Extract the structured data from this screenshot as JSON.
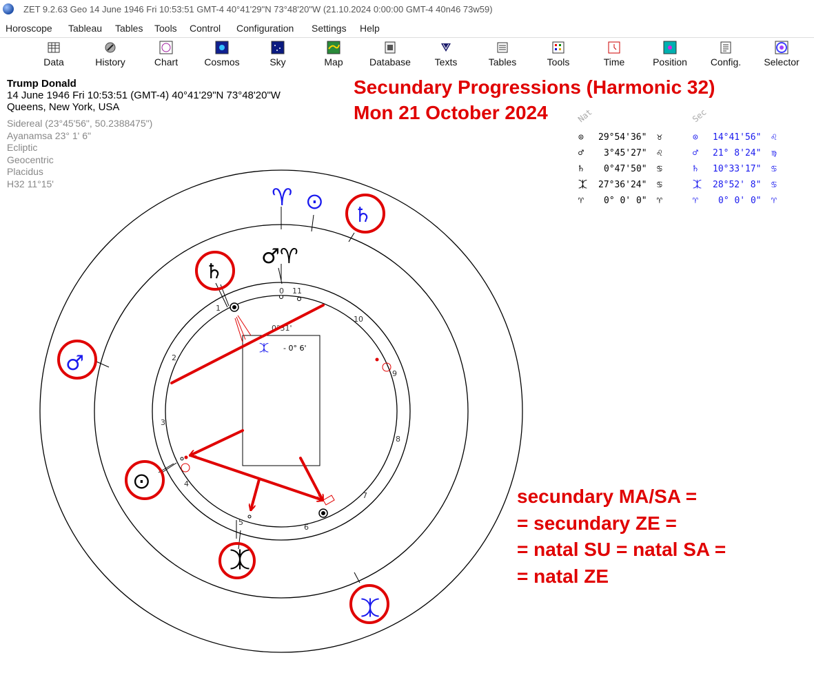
{
  "window": {
    "title": "ZET 9.2.63 Geo    14 June 1946  Fri  10:53:51 GMT-4 40°41'29\"N  73°48'20\"W  (21.10.2024   0:00:00 GMT-4 40n46 73w59)"
  },
  "menu": [
    "Horoscope",
    "Tableau",
    "Tables",
    "Tools",
    "Control",
    "Configuration",
    "Settings",
    "Help"
  ],
  "toolbar": [
    {
      "label": "Data",
      "icon": "data-icon"
    },
    {
      "label": "History",
      "icon": "history-icon"
    },
    {
      "label": "Chart",
      "icon": "chart-icon"
    },
    {
      "label": "Cosmos",
      "icon": "cosmos-icon"
    },
    {
      "label": "Sky",
      "icon": "sky-icon"
    },
    {
      "label": "Map",
      "icon": "map-icon"
    },
    {
      "label": "Database",
      "icon": "database-icon"
    },
    {
      "label": "Texts",
      "icon": "texts-icon"
    },
    {
      "label": "Tables",
      "icon": "tables-icon"
    },
    {
      "label": "Tools",
      "icon": "tools-icon"
    },
    {
      "label": "Time",
      "icon": "time-icon"
    },
    {
      "label": "Position",
      "icon": "position-icon"
    },
    {
      "label": "Config.",
      "icon": "config-icon"
    },
    {
      "label": "Selector",
      "icon": "selector-icon"
    }
  ],
  "info": {
    "name": "Trump Donald",
    "datetime": "14 June 1946  Fri  10:53:51 (GMT-4) 40°41'29\"N  73°48'20\"W",
    "place": "Queens, New York, USA",
    "settings": [
      "Sidereal (23°45'56\", 50.2388475\")",
      "Ayanamsa 23° 1' 6\"",
      "Ecliptic",
      "Geocentric",
      "Placidus",
      "H32  11°15'"
    ]
  },
  "headline": {
    "line1": "Secundary Progressions (Harmonic 32)",
    "line2": "Mon 21 October 2024"
  },
  "positions": {
    "nat_header": "Nat",
    "sec_header": "Sec",
    "natal": [
      {
        "glyph": "⊙",
        "value": "29°54'36\"",
        "sign": "♉"
      },
      {
        "glyph": "♂",
        "value": "3°45'27\"",
        "sign": "♌"
      },
      {
        "glyph": "♄",
        "value": "0°47'50\"",
        "sign": "♋"
      },
      {
        "glyph": "⯰",
        "value": "27°36'24\"",
        "sign": "♋"
      },
      {
        "glyph": "♈",
        "value": "0° 0' 0\"",
        "sign": "♈"
      }
    ],
    "secondary": [
      {
        "glyph": "⊙",
        "value": "14°41'56\"",
        "sign": "♌"
      },
      {
        "glyph": "♂",
        "value": "21° 8'24\"",
        "sign": "♍"
      },
      {
        "glyph": "♄",
        "value": "10°33'17\"",
        "sign": "♋"
      },
      {
        "glyph": "⯰",
        "value": "28°52' 8\"",
        "sign": "♋"
      },
      {
        "glyph": "♈",
        "value": "0° 0' 0\"",
        "sign": "♈"
      }
    ],
    "colors": {
      "natal": "#000000",
      "secondary": "#1a1aee"
    }
  },
  "chart": {
    "inner_label_top": "0°31'",
    "box_glyph": "⯰",
    "box_value": "- 0° 6'",
    "house_numbers": [
      "0",
      "11",
      "10",
      "9",
      "8",
      "7",
      "6",
      "5",
      "4",
      "3",
      "2",
      "1"
    ],
    "outer_glyphs": {
      "aries": "♈",
      "sun": "⊙",
      "saturn": "♄",
      "mars": "♂",
      "zeus": "⯰"
    },
    "middle_glyphs": {
      "mars_aries": "♂♈"
    },
    "natal_glyphs": {
      "saturn": "♄",
      "sun": "⊙",
      "zeus": "⯰"
    },
    "accent": "#e00000",
    "blue": "#1a1aee"
  },
  "annotation": {
    "line1": "secundary MA/SA =",
    "line2": "= secundary ZE =",
    "line3": "= natal SU = natal SA =",
    "line4": "= natal ZE"
  }
}
